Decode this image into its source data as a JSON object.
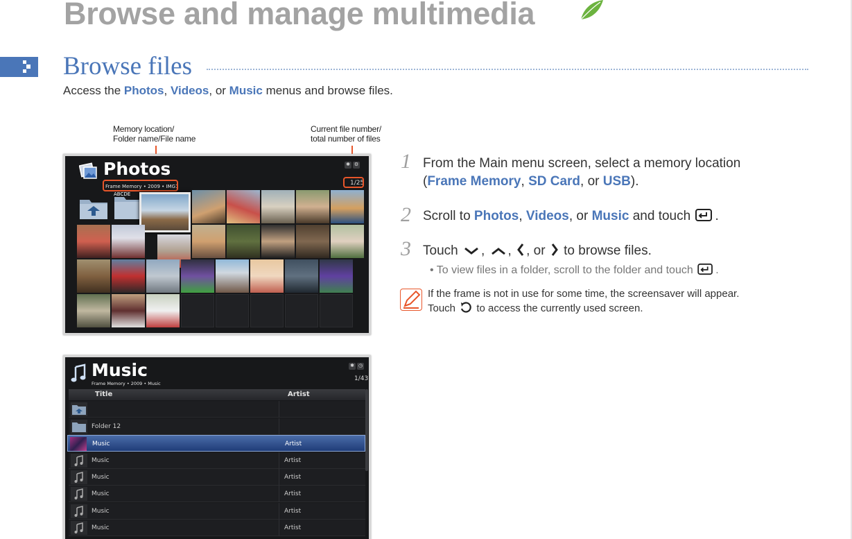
{
  "heading": "Browse and manage multimedia",
  "section_title": "Browse files",
  "intro": {
    "pre": "Access the ",
    "photos": "Photos",
    "sep1": ", ",
    "videos": "Videos",
    "sep2": ", or ",
    "music": "Music",
    "post": " menus and browse files."
  },
  "callouts": {
    "left_line1": "Memory location/",
    "left_line2": "Folder name/File name",
    "right_line1": "Current file number/",
    "right_line2": "total number of files"
  },
  "photos_screen": {
    "title": "Photos",
    "path": "Frame Memory • 2009 • IMG1",
    "count": "1/25",
    "folder_label": "ABCDE"
  },
  "music_screen": {
    "title": "Music",
    "path": "Frame Memory • 2009 • Music",
    "count": "1/43",
    "col_title": "Title",
    "col_artist": "Artist",
    "rows": [
      {
        "title": "",
        "artist": ""
      },
      {
        "title": "Folder 12",
        "artist": ""
      },
      {
        "title": "Music",
        "artist": "Artist"
      },
      {
        "title": "Music",
        "artist": "Artist"
      },
      {
        "title": "Music",
        "artist": "Artist"
      },
      {
        "title": "Music",
        "artist": "Artist"
      },
      {
        "title": "Music",
        "artist": "Artist"
      },
      {
        "title": "Music",
        "artist": "Artist"
      }
    ]
  },
  "steps": [
    {
      "num": "1",
      "line1": "From the Main menu screen, select a memory location",
      "l2_pre": "(",
      "l2_a": "Frame Memory",
      "l2_sep1": ", ",
      "l2_b": "SD Card",
      "l2_sep2": ", or ",
      "l2_c": "USB",
      "l2_post": ")."
    },
    {
      "num": "2",
      "pre": "Scroll to ",
      "a": "Photos",
      "sep1": ", ",
      "b": "Videos",
      "sep2": ", or ",
      "c": "Music",
      "post": " and touch",
      "end": "."
    },
    {
      "num": "3",
      "pre": "Touch",
      "sep1": ",",
      "sep2": ",",
      "sep3": ", or",
      "post": "to browse files."
    }
  ],
  "bullet": {
    "text": "•  To view files in a folder, scroll to the folder and touch",
    "end": "."
  },
  "note": {
    "line1": "If the frame is not in use for some time, the screensaver will appear.",
    "line2_pre": "Touch",
    "line2_post": "to access the currently used screen."
  },
  "colors": {
    "accent_blue": "#4a76b8",
    "callout_orange": "#e8562a",
    "heading_gray": "#a3a3a3"
  },
  "icons": [
    "leaf-icon",
    "enter-icon",
    "chevron-down-icon",
    "chevron-up-icon",
    "chevron-left-icon",
    "chevron-right-icon",
    "return-icon",
    "note-pencil-icon",
    "music-note-icon",
    "folder-up-icon",
    "bluetooth-icon",
    "settings-icon"
  ]
}
